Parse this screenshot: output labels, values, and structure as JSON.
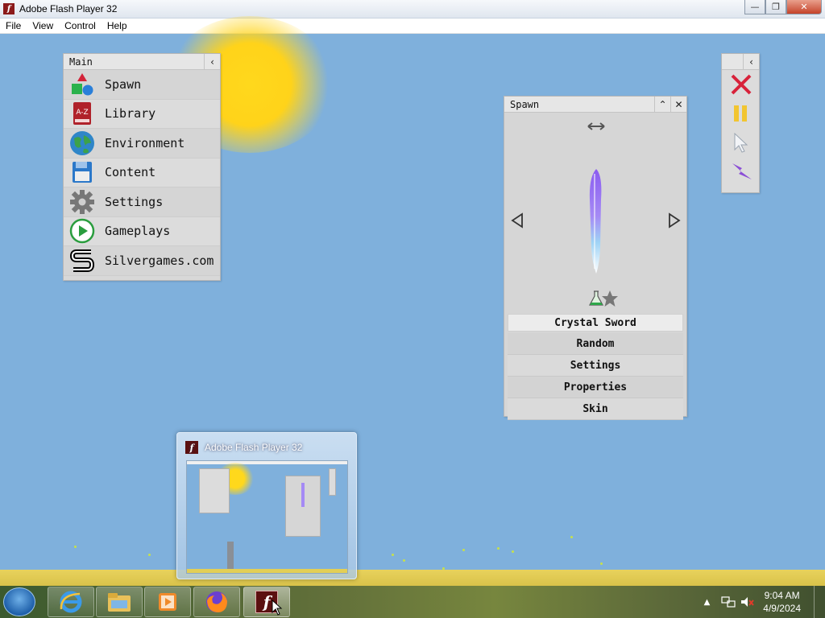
{
  "window": {
    "title": "Adobe Flash Player 32",
    "controls": [
      "minimize",
      "maximize",
      "close"
    ]
  },
  "menubar": [
    "File",
    "View",
    "Control",
    "Help"
  ],
  "main_panel": {
    "title": "Main",
    "items": [
      {
        "label": "Spawn",
        "icon": "shapes-icon"
      },
      {
        "label": "Library",
        "icon": "book-az-icon"
      },
      {
        "label": "Environment",
        "icon": "globe-icon"
      },
      {
        "label": "Content",
        "icon": "floppy-disk-icon"
      },
      {
        "label": "Settings",
        "icon": "gear-icon"
      },
      {
        "label": "Gameplays",
        "icon": "play-icon"
      },
      {
        "label": "Silvergames.com",
        "icon": "silvergames-logo-icon"
      }
    ]
  },
  "spawn_panel": {
    "title": "Spawn",
    "selected_item": "Crystal Sword",
    "buttons": [
      "Random",
      "Settings",
      "Properties",
      "Skin"
    ]
  },
  "tool_panel": {
    "tools": [
      "close-x-icon",
      "pause-icon",
      "cursor-icon",
      "lightning-icon"
    ]
  },
  "taskbar": {
    "pinned": [
      "internet-explorer-icon",
      "file-explorer-icon",
      "media-player-icon",
      "firefox-icon",
      "flash-player-icon"
    ],
    "active": "flash-player-icon",
    "clock_time": "9:04 AM",
    "clock_date": "4/9/2024"
  },
  "thumbnail": {
    "title": "Adobe Flash Player 32"
  },
  "colors": {
    "sky": "#7fb0dc",
    "sun": "#ffd81c",
    "ground": "#e8d25c",
    "panel": "#d8d8d8"
  }
}
